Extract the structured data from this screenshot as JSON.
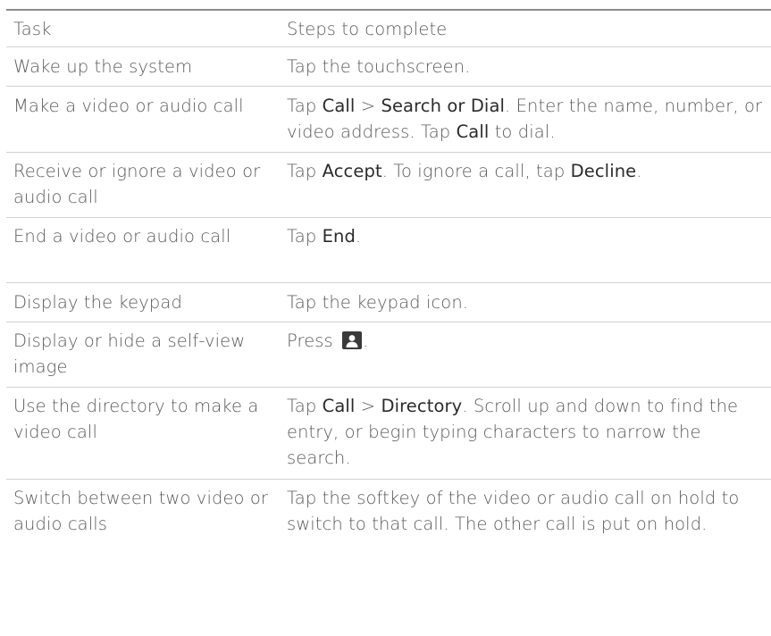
{
  "header": {
    "task": "Task",
    "steps": "Steps to complete"
  },
  "rows": [
    {
      "task": "Wake up the system",
      "steps": [
        "Tap the touchscreen."
      ]
    },
    {
      "task": "Make a video or audio call",
      "steps": [
        "Tap ",
        "Call",
        " > ",
        "Search or Dial",
        ". Enter the name, number, or video address. Tap ",
        "Call",
        " to dial."
      ]
    },
    {
      "task": "Receive or ignore a video or audio call",
      "steps": [
        "Tap ",
        "Accept",
        ". To ignore a call, tap ",
        "Decline",
        "."
      ]
    },
    {
      "task": "End a video or audio call",
      "steps": [
        "Tap ",
        "End",
        "."
      ]
    },
    {
      "task": "Display the keypad",
      "steps": [
        "Tap the keypad icon."
      ]
    },
    {
      "task": "Display or hide a self-view image",
      "steps": [
        "Press ",
        "."
      ],
      "icon": "self-view-icon"
    },
    {
      "task": "Use the directory to make a video call",
      "steps": [
        "Tap ",
        "Call",
        " > ",
        "Directory",
        ". Scroll up and down to find the entry, or begin typing characters to narrow the search."
      ]
    },
    {
      "task": "Switch between two video or audio calls",
      "steps": [
        "Tap the softkey of the video or audio call on hold to switch to that call. The other call is put on hold."
      ]
    }
  ],
  "colors": {
    "text": "#5a5a5a",
    "keyword": "#2b2b2b",
    "top_rule": "#8c8c8c",
    "row_divider": "#d2d2d2"
  }
}
